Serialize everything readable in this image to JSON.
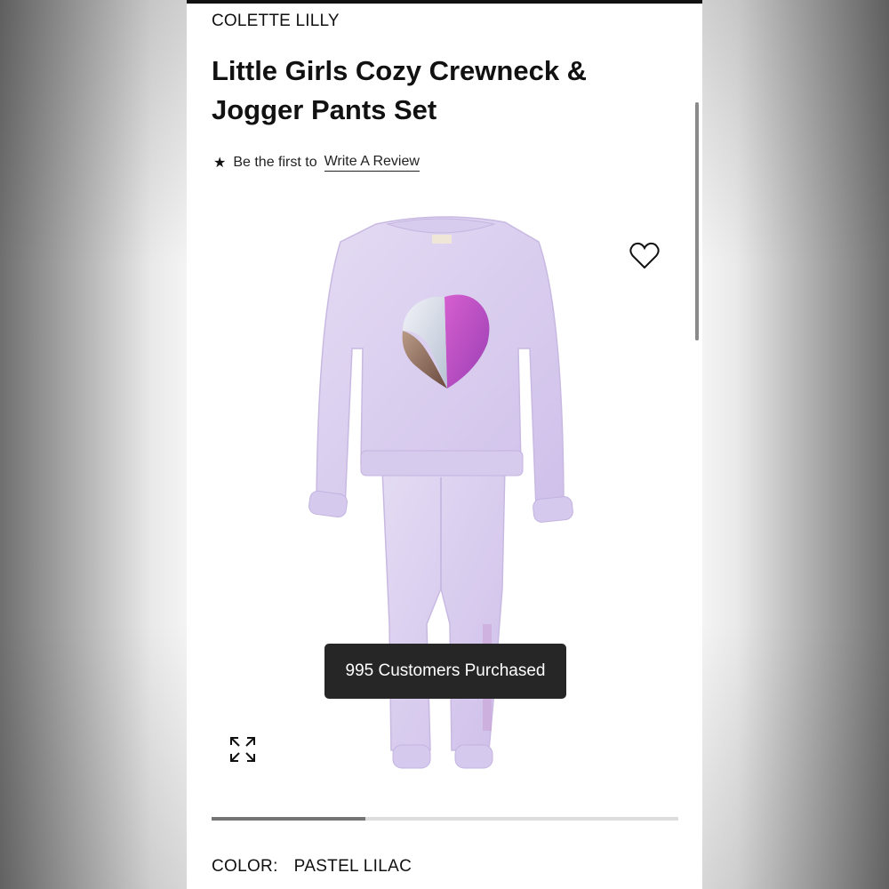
{
  "product": {
    "brand": "COLETTE LILLY",
    "title": "Little Girls Cozy Crewneck & Jogger Pants Set",
    "review_prompt": "Be the first to",
    "review_link": "Write A Review",
    "purchase_toast": "995 Customers Purchased",
    "color_label": "COLOR:",
    "color_value": "PASTEL LILAC"
  },
  "gallery": {
    "progress_fraction": 0.33
  },
  "icons": {
    "star": "star-icon",
    "favorite": "heart-outline-icon",
    "expand": "expand-arrows-icon"
  },
  "colors": {
    "garment": "#dcd0ef",
    "accent_text": "#111111",
    "toast_bg": "#262626"
  }
}
